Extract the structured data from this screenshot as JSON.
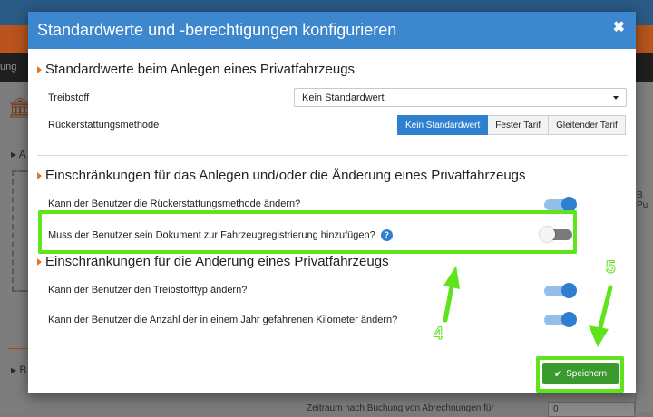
{
  "background": {
    "menu_text": "ung",
    "left_text_1": "A",
    "left_text_2": "B",
    "right_text": "B Pu",
    "bottom_text": "Zeitraum nach Buchung von Abrechnungen für",
    "bottom_value": "0"
  },
  "modal": {
    "title": "Standardwerte und -berechtigungen konfigurieren",
    "close_symbol": "✖"
  },
  "section1": {
    "heading": "Standardwerte beim Anlegen eines Privatfahrzeugs",
    "fuel_label": "Treibstoff",
    "fuel_value": "Kein Standardwert",
    "refund_label": "Rückerstattungsmethode",
    "refund_options": [
      "Kein Standardwert",
      "Fester Tarif",
      "Gleitender Tarif"
    ],
    "refund_selected": 0
  },
  "section2": {
    "heading": "Einschränkungen für das Anlegen und/oder die Änderung eines Privatfahrzeugs",
    "row1_label": "Kann der Benutzer die Rückerstattungsmethode ändern?",
    "row1_on": true,
    "row2_label": "Muss der Benutzer sein Dokument zur Fahrzeugregistrierung hinzufügen?",
    "row2_help": "?",
    "row2_on": false
  },
  "section3": {
    "heading": "Einschränkungen für die Anderung eines Privatfahrzeugs",
    "row1_label": "Kann der Benutzer den Treibstofftyp ändern?",
    "row1_on": true,
    "row2_label": "Kann der Benutzer die Anzahl der in einem Jahr gefahrenen Kilometer ändern?",
    "row2_on": true
  },
  "footer": {
    "save_label": "Speichern",
    "save_icon": "check-icon"
  },
  "annotations": {
    "step4": "4",
    "step5": "5",
    "color": "#5ee31c"
  }
}
